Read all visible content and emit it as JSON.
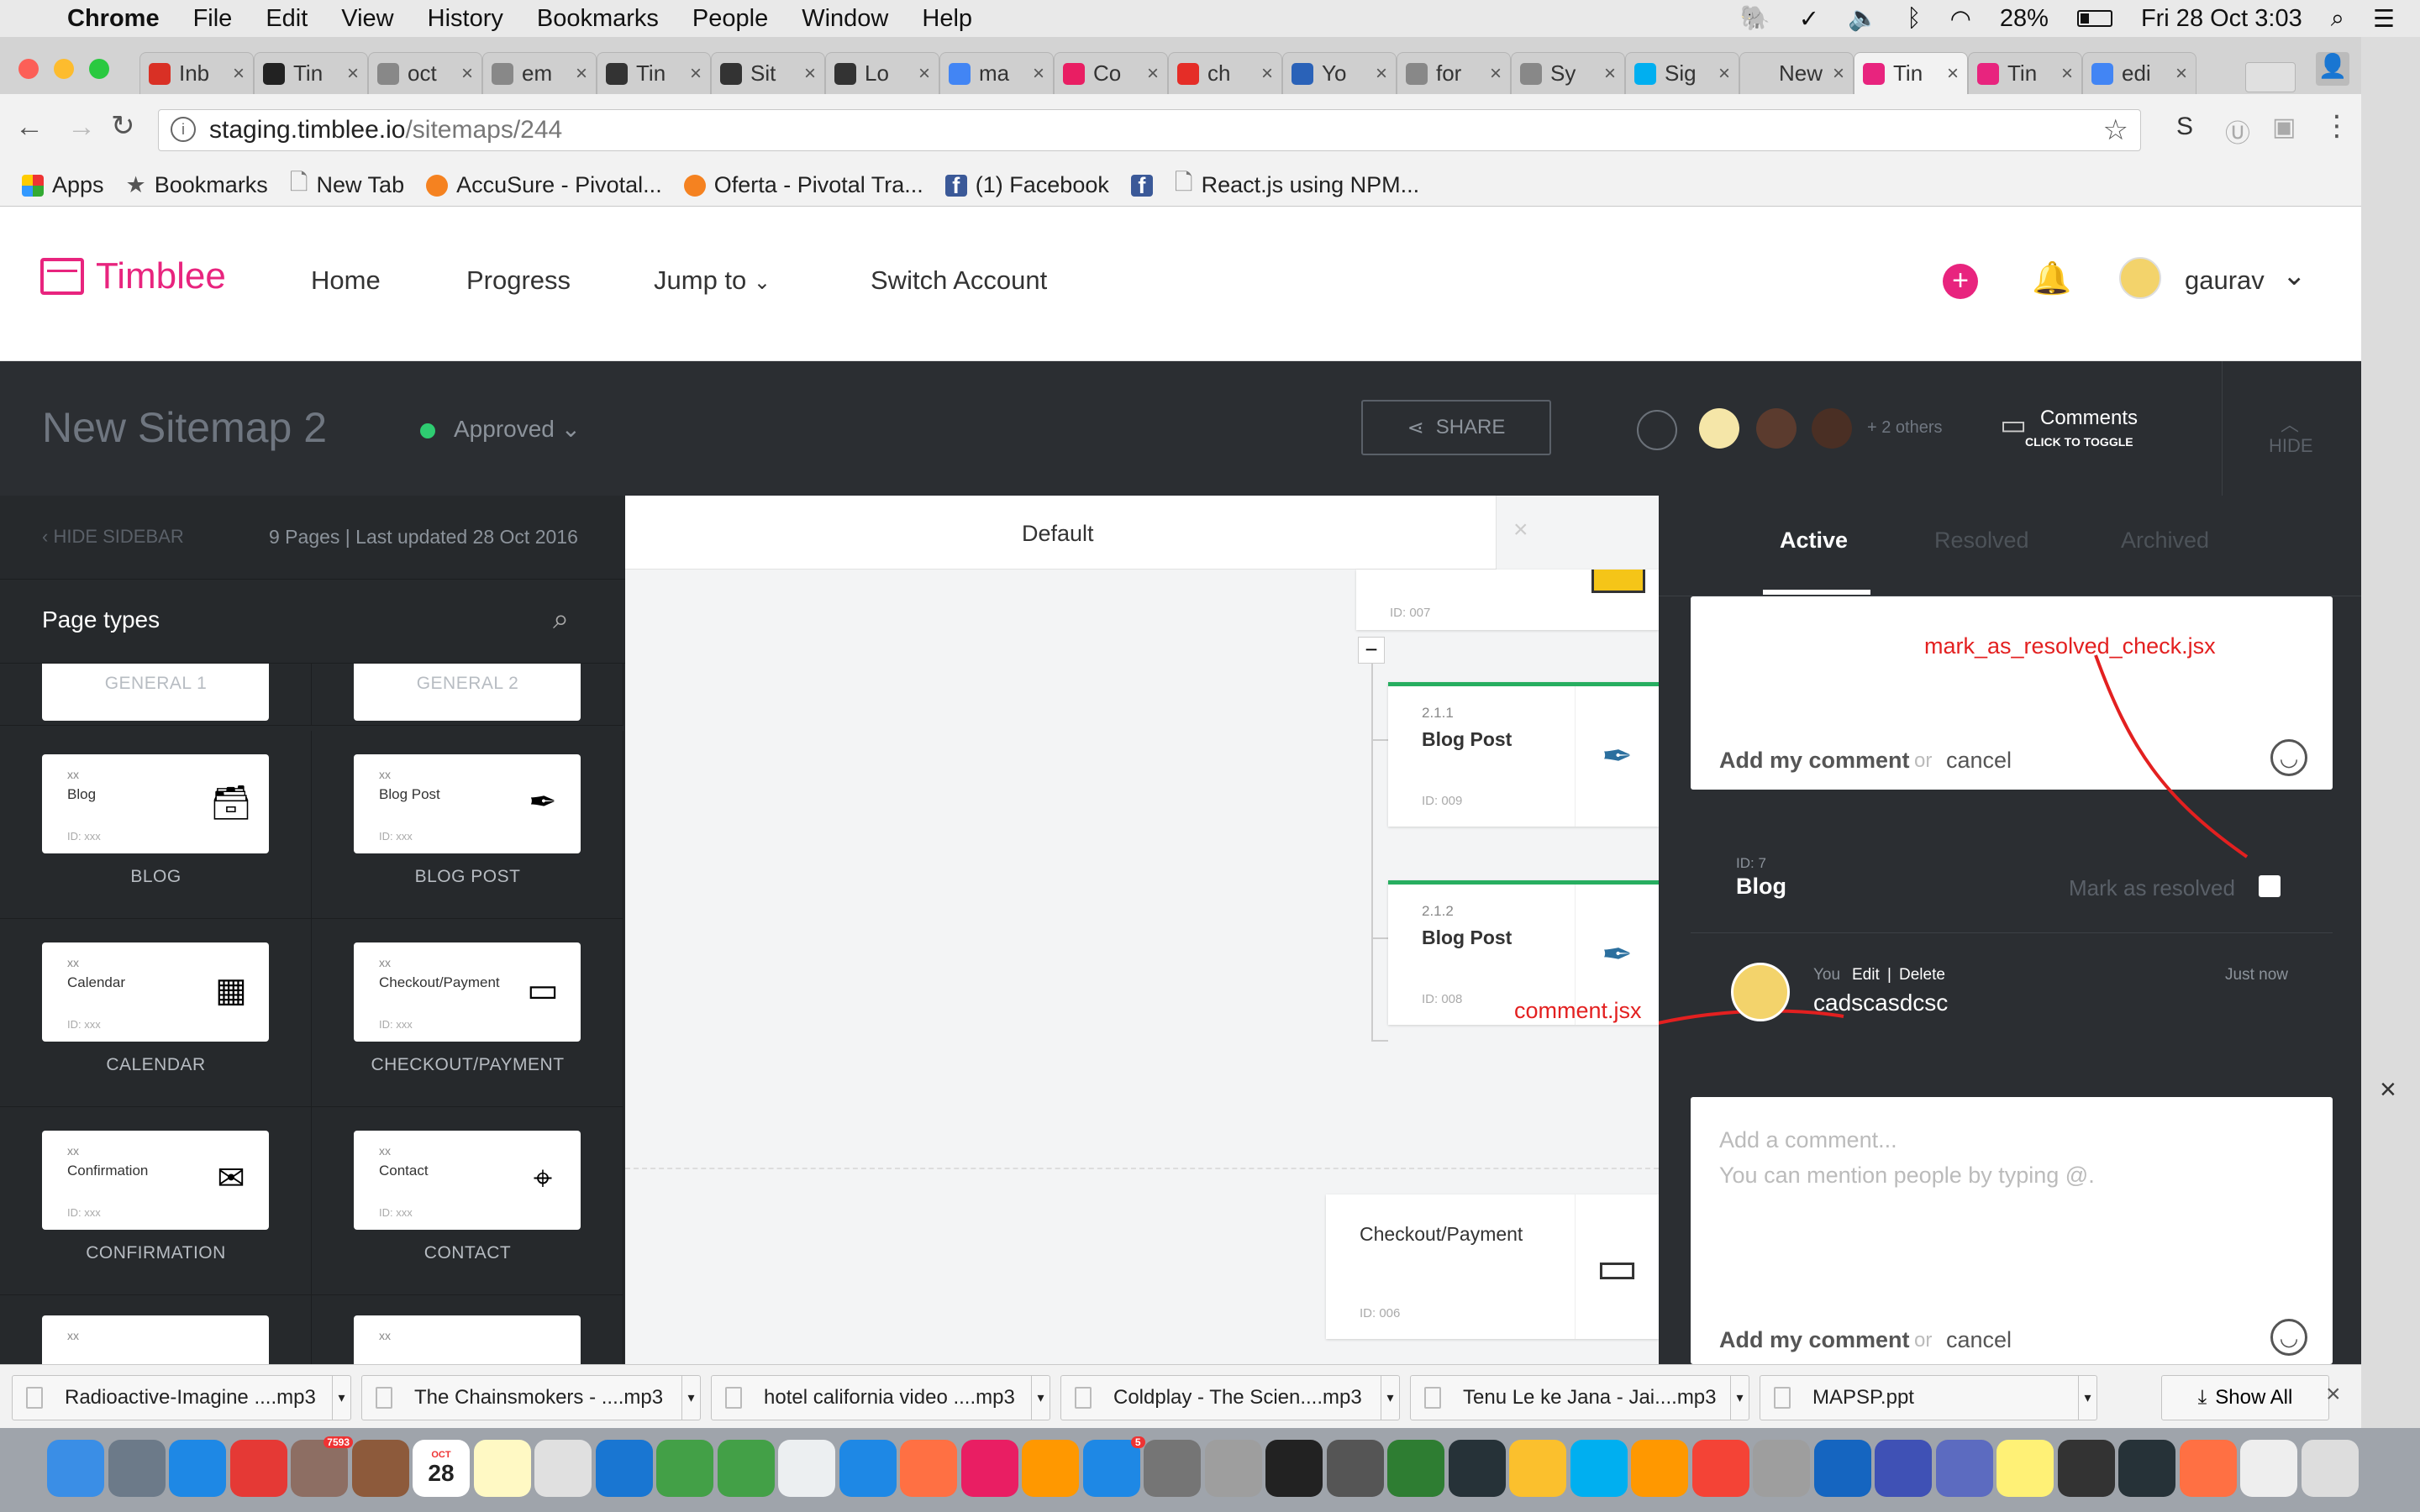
{
  "menubar": {
    "app": "Chrome",
    "items": [
      "File",
      "Edit",
      "View",
      "History",
      "Bookmarks",
      "People",
      "Window",
      "Help"
    ],
    "battery": "28%",
    "datetime": "Fri 28 Oct  3:03"
  },
  "tabs": [
    {
      "label": "Inb",
      "icon": "gmail-icon",
      "color": "#d93025"
    },
    {
      "label": "Tin",
      "icon": "bh-icon",
      "color": "#222"
    },
    {
      "label": "oct",
      "icon": "doc-icon",
      "color": "#888"
    },
    {
      "label": "em",
      "icon": "doc-icon",
      "color": "#888"
    },
    {
      "label": "Tin",
      "icon": "trello-icon",
      "color": "#333"
    },
    {
      "label": "Sit",
      "icon": "trello-icon",
      "color": "#333"
    },
    {
      "label": "Lo",
      "icon": "trello-icon",
      "color": "#333"
    },
    {
      "label": "ma",
      "icon": "google-icon",
      "color": "#4285f4"
    },
    {
      "label": "Co",
      "icon": "invision-icon",
      "color": "#e91e63"
    },
    {
      "label": "ch",
      "icon": "youtube-icon",
      "color": "#e52d27"
    },
    {
      "label": "Yo",
      "icon": "ytmp3-icon",
      "color": "#2a62b8"
    },
    {
      "label": "for",
      "icon": "doc-icon",
      "color": "#888"
    },
    {
      "label": "Sy",
      "icon": "doc-icon",
      "color": "#888"
    },
    {
      "label": "Sig",
      "icon": "skype-icon",
      "color": "#00aff0"
    },
    {
      "label": "New T",
      "icon": "",
      "color": "#cfcfcf"
    },
    {
      "label": "Tin",
      "icon": "timblee-icon",
      "color": "#e8247e"
    },
    {
      "label": "Tin",
      "icon": "timblee-icon",
      "color": "#e8247e"
    },
    {
      "label": "edi",
      "icon": "google-icon",
      "color": "#4285f4"
    }
  ],
  "address": {
    "domain": "staging.timblee.io",
    "path": "/sitemaps/244"
  },
  "bookmarks": [
    "Apps",
    "Bookmarks",
    "New Tab",
    "AccuSure - Pivotal...",
    "Oferta - Pivotal Tra...",
    "(1) Facebook",
    "",
    "React.js using NPM..."
  ],
  "app": {
    "brand": "Timblee",
    "nav": [
      "Home",
      "Progress",
      "Jump to",
      "Switch Account"
    ],
    "username": "gaurav",
    "brand_color": "#e8247e"
  },
  "sitemap": {
    "title": "New Sitemap 2",
    "status": "Approved",
    "status_color": "#2ecc71",
    "share_label": "SHARE",
    "others": "+ 2 others",
    "comments_label": "Comments",
    "comments_sub": "CLICK TO TOGGLE",
    "hide_label": "HIDE"
  },
  "sidebar": {
    "hide_label": "HIDE SIDEBAR",
    "meta": "9 Pages | Last updated 28 Oct 2016",
    "section_title": "Page types",
    "top_labels": [
      "GENERAL 1",
      "GENERAL 2"
    ],
    "types": [
      {
        "name": "Blog",
        "label": "BLOG",
        "icon": "inbox-icon",
        "glyph": "🗃"
      },
      {
        "name": "Blog Post",
        "label": "BLOG POST",
        "icon": "quill-icon",
        "glyph": "✒"
      },
      {
        "name": "Calendar",
        "label": "CALENDAR",
        "icon": "calendar-icon",
        "glyph": "▦"
      },
      {
        "name": "Checkout/Payment",
        "label": "CHECKOUT/PAYMENT",
        "icon": "credit-card-icon",
        "glyph": "▭"
      },
      {
        "name": "Confirmation",
        "label": "CONFIRMATION",
        "icon": "envelope-check-icon",
        "glyph": "✉"
      },
      {
        "name": "Contact",
        "label": "CONTACT",
        "icon": "map-pin-icon",
        "glyph": "⌖"
      }
    ],
    "card_xx": "xx",
    "card_id": "ID: xxx"
  },
  "canvas": {
    "tab": "Default",
    "nodes": [
      {
        "num": "",
        "title": "",
        "id": "ID: 007"
      },
      {
        "num": "2.1.1",
        "title": "Blog Post",
        "id": "ID: 009"
      },
      {
        "num": "2.1.2",
        "title": "Blog Post",
        "id": "ID: 008"
      },
      {
        "num": "",
        "title": "Checkout/Payment",
        "id": "ID: 006"
      }
    ]
  },
  "comments": {
    "tabs": [
      "Active",
      "Resolved",
      "Archived"
    ],
    "add_label": "Add my comment",
    "or": "or",
    "cancel": "cancel",
    "annotation_resolve": "mark_as_resolved_check.jsx",
    "annotation_comment": "comment.jsx",
    "thread": {
      "id": "ID: 7",
      "page": "Blog",
      "mark_resolved": "Mark as resolved",
      "author": "You",
      "edit": "Edit",
      "delete": "Delete",
      "time": "Just now",
      "text": "cadscasdcsc"
    },
    "placeholder": "Add a comment...\nYou can mention people by typing @."
  },
  "downloads": {
    "files": [
      "Radioactive-Imagine ....mp3",
      "The Chainsmokers - ....mp3",
      "hotel california video ....mp3",
      "Coldplay - The Scien....mp3",
      "Tenu Le ke Jana - Jai....mp3",
      "MAPSP.ppt"
    ],
    "show_all": "Show All"
  },
  "dock": {
    "calendar_day": "28",
    "calendar_month": "OCT",
    "mail_badge": "7593",
    "appstore_badge": "5"
  }
}
